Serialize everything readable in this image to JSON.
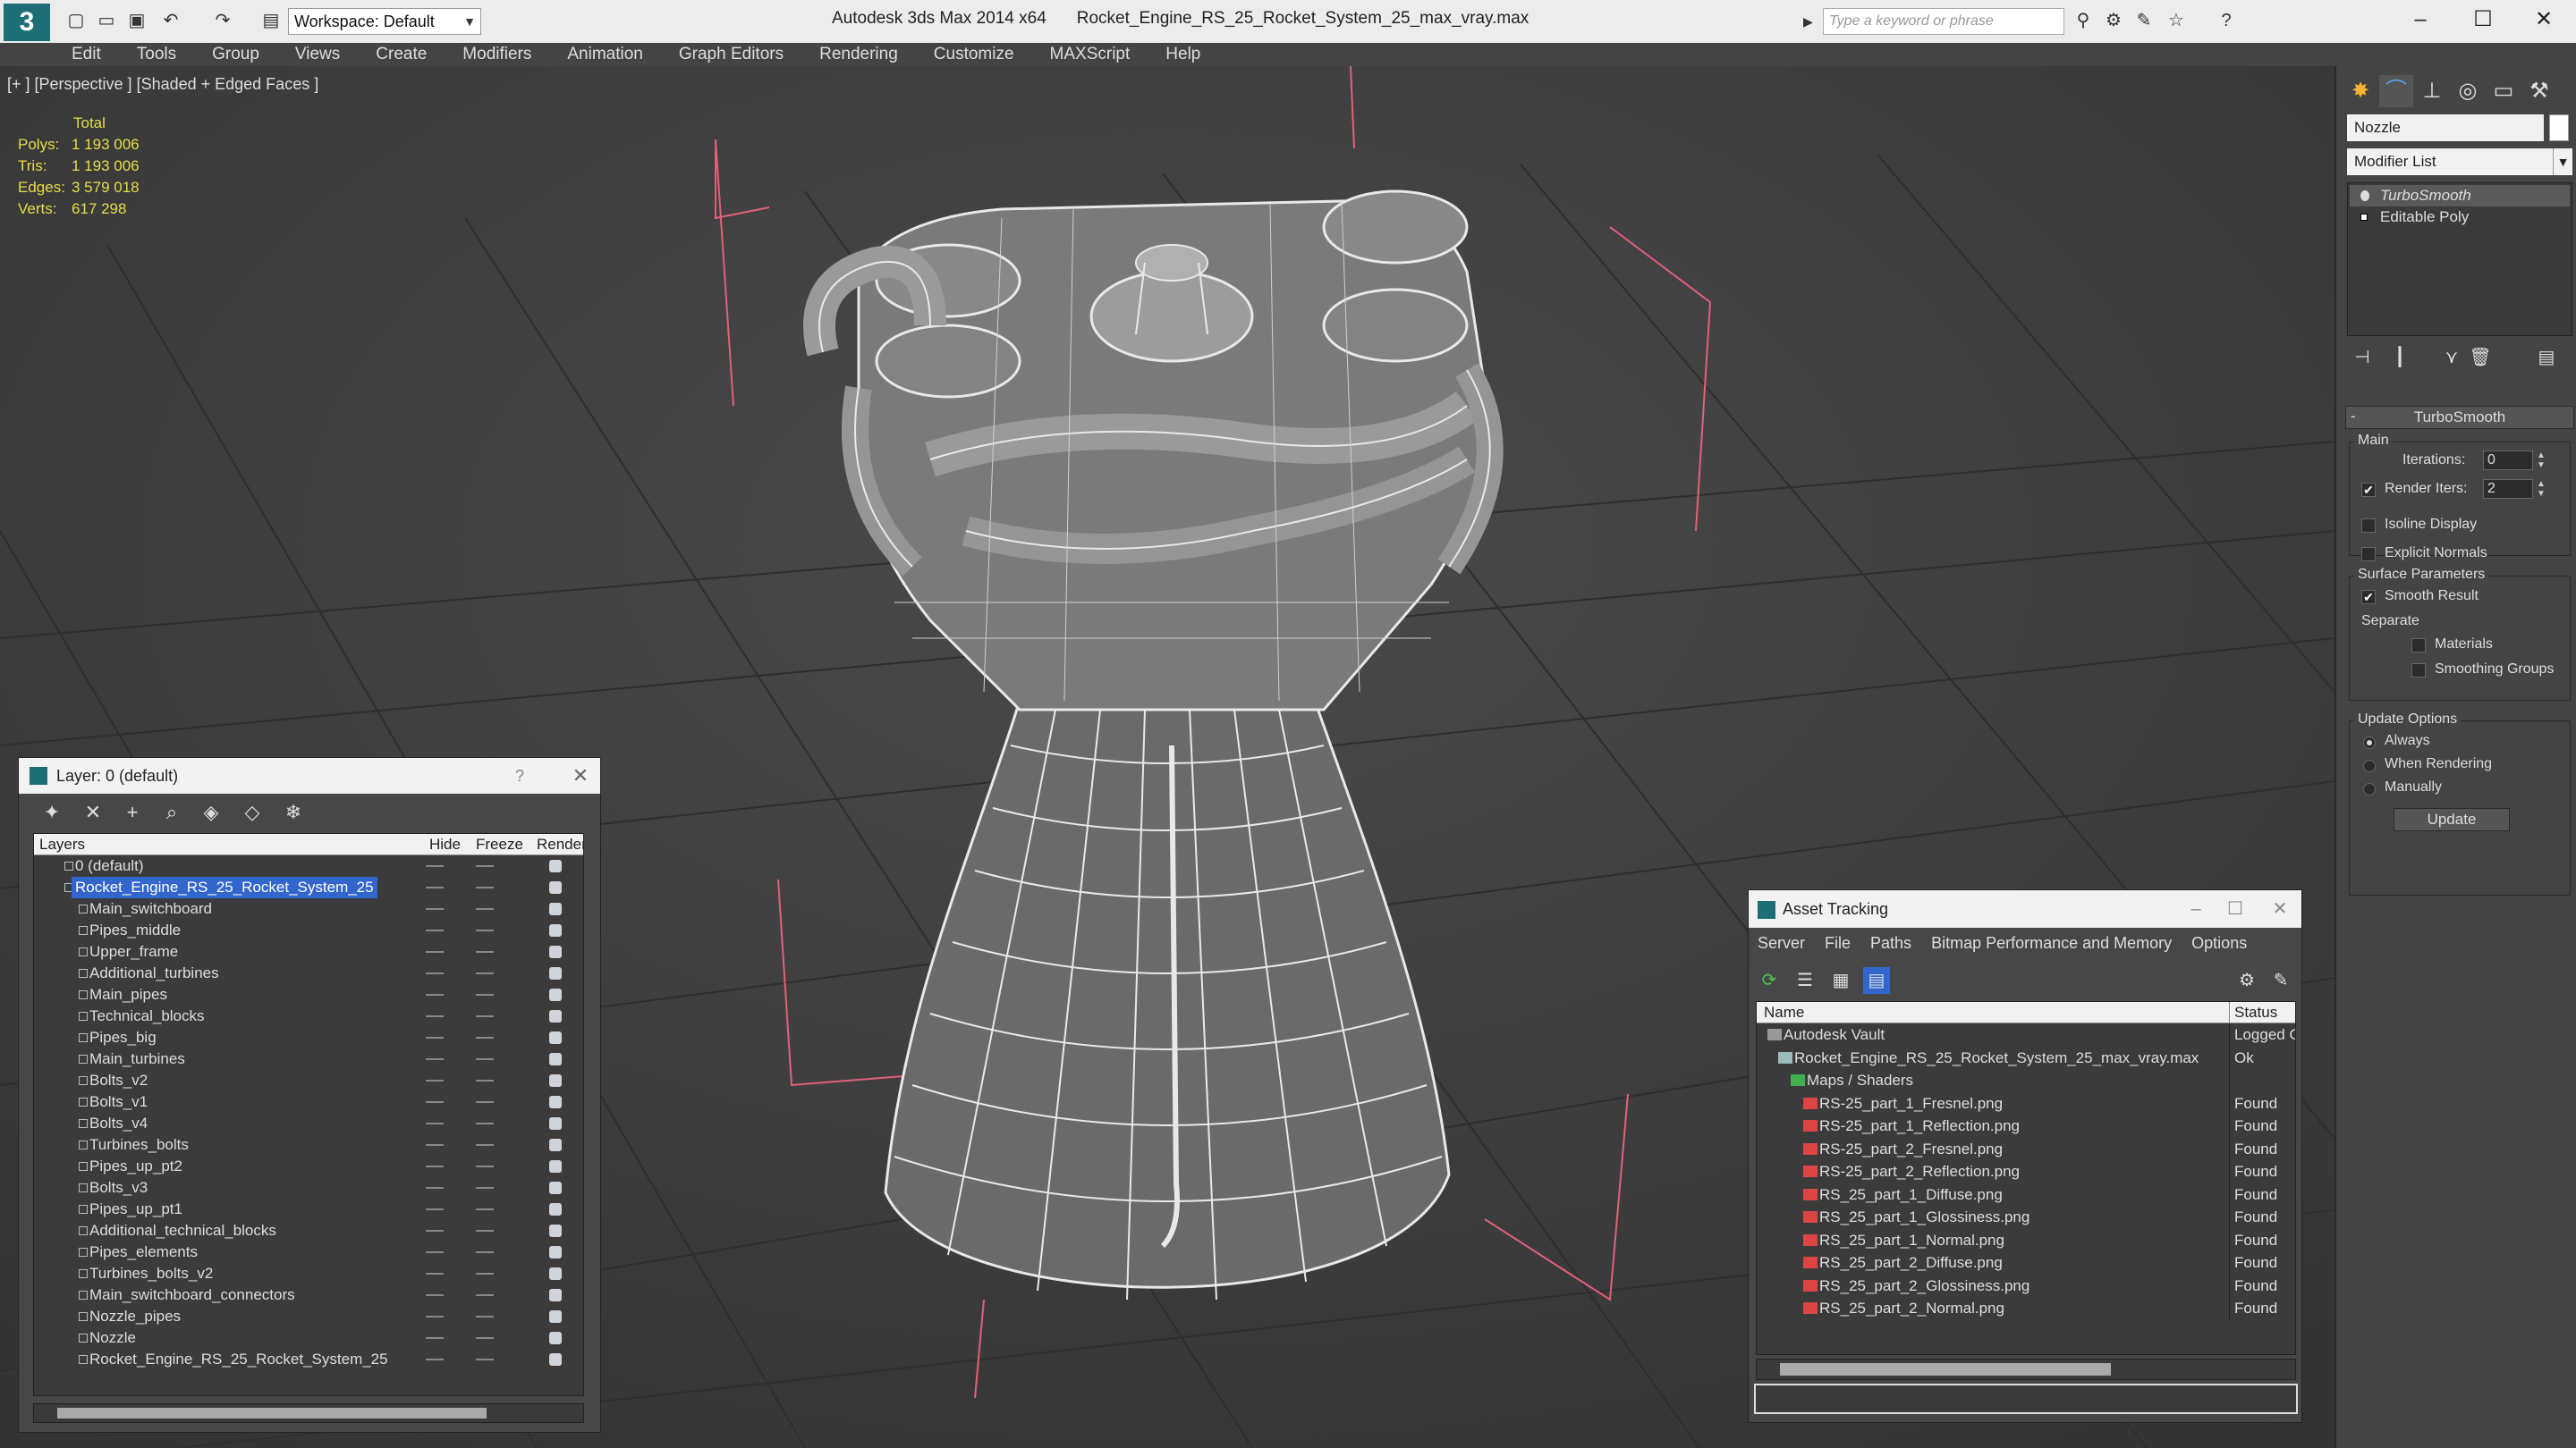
{
  "window": {
    "app_name": "Autodesk 3ds Max  2014 x64",
    "file_name": "Rocket_Engine_RS_25_Rocket_System_25_max_vray.max",
    "workspace": "Workspace: Default",
    "search_placeholder": "Type a keyword or phrase"
  },
  "menu": [
    "Edit",
    "Tools",
    "Group",
    "Views",
    "Create",
    "Modifiers",
    "Animation",
    "Graph Editors",
    "Rendering",
    "Customize",
    "MAXScript",
    "Help"
  ],
  "viewport": {
    "label": "[+ ] [Perspective ] [Shaded + Edged Faces ]",
    "stats": {
      "header": "Total",
      "rows": [
        {
          "label": "Polys:",
          "value": "1 193 006"
        },
        {
          "label": "Tris:",
          "value": "1 193 006"
        },
        {
          "label": "Edges:",
          "value": "3 579 018"
        },
        {
          "label": "Verts:",
          "value": "617 298"
        }
      ]
    }
  },
  "layer_panel": {
    "title": "Layer: 0 (default)",
    "help": "?",
    "columns": {
      "layers": "Layers",
      "hide": "Hide",
      "freeze": "Freeze",
      "render": "Render"
    },
    "default_layer": "0 (default)",
    "selected_layer": "Rocket_Engine_RS_25_Rocket_System_25",
    "children": [
      "Main_switchboard",
      "Pipes_middle",
      "Upper_frame",
      "Additional_turbines",
      "Main_pipes",
      "Technical_blocks",
      "Pipes_big",
      "Main_turbines",
      "Bolts_v2",
      "Bolts_v1",
      "Bolts_v4",
      "Turbines_bolts",
      "Pipes_up_pt2",
      "Bolts_v3",
      "Pipes_up_pt1",
      "Additional_technical_blocks",
      "Pipes_elements",
      "Turbines_bolts_v2",
      "Main_switchboard_connectors",
      "Nozzle_pipes",
      "Nozzle",
      "Rocket_Engine_RS_25_Rocket_System_25"
    ]
  },
  "asset_panel": {
    "title": "Asset Tracking",
    "menu": [
      "Server",
      "File",
      "Paths",
      "Bitmap Performance and Memory",
      "Options"
    ],
    "columns": {
      "name": "Name",
      "status": "Status"
    },
    "vault": {
      "name": "Autodesk Vault",
      "status": "Logged O"
    },
    "max_file": {
      "name": "Rocket_Engine_RS_25_Rocket_System_25_max_vray.max",
      "status": "Ok"
    },
    "maps_group": "Maps / Shaders",
    "maps": [
      {
        "name": "RS-25_part_1_Fresnel.png",
        "status": "Found"
      },
      {
        "name": "RS-25_part_1_Reflection.png",
        "status": "Found"
      },
      {
        "name": "RS-25_part_2_Fresnel.png",
        "status": "Found"
      },
      {
        "name": "RS-25_part_2_Reflection.png",
        "status": "Found"
      },
      {
        "name": "RS_25_part_1_Diffuse.png",
        "status": "Found"
      },
      {
        "name": "RS_25_part_1_Glossiness.png",
        "status": "Found"
      },
      {
        "name": "RS_25_part_1_Normal.png",
        "status": "Found"
      },
      {
        "name": "RS_25_part_2_Diffuse.png",
        "status": "Found"
      },
      {
        "name": "RS_25_part_2_Glossiness.png",
        "status": "Found"
      },
      {
        "name": "RS_25_part_2_Normal.png",
        "status": "Found"
      }
    ]
  },
  "command_panel": {
    "object_name": "Nozzle",
    "modifier_list": "Modifier List",
    "stack": [
      "TurboSmooth",
      "Editable Poly"
    ],
    "rollout": {
      "title": "TurboSmooth",
      "main_label": "Main",
      "iterations_label": "Iterations:",
      "iterations_value": "0",
      "render_iters_label": "Render Iters:",
      "render_iters_value": "2",
      "render_iters_checked": true,
      "isoline_label": "Isoline Display",
      "explicit_normals_label": "Explicit Normals",
      "surface_params_label": "Surface Parameters",
      "smooth_result_label": "Smooth Result",
      "smooth_result_checked": true,
      "separate_label": "Separate",
      "materials_label": "Materials",
      "smoothing_groups_label": "Smoothing Groups",
      "update_options_label": "Update Options",
      "always_label": "Always",
      "when_rendering_label": "When Rendering",
      "manually_label": "Manually",
      "update_button": "Update"
    }
  },
  "colors": {
    "accent_teal": "#1d6f75",
    "selection_blue": "#3366cc",
    "stats_yellow": "#e6dd4a",
    "wireframe": "#e8e8e8",
    "bbox_pink": "#e0607a"
  }
}
